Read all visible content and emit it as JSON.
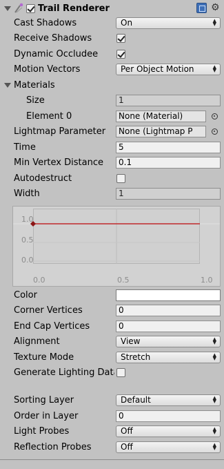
{
  "component": {
    "title": "Trail Renderer",
    "enabled": true
  },
  "colors": {
    "panel_bg": "#c2c2c2",
    "curve": "#c0282a"
  },
  "properties": {
    "cast_shadows": {
      "label": "Cast Shadows",
      "value": "On"
    },
    "receive_shadows": {
      "label": "Receive Shadows",
      "checked": true
    },
    "dynamic_occludee": {
      "label": "Dynamic Occludee",
      "checked": true
    },
    "motion_vectors": {
      "label": "Motion Vectors",
      "value": "Per Object Motion"
    },
    "materials": {
      "label": "Materials"
    },
    "size": {
      "label": "Size",
      "value": "1"
    },
    "element0": {
      "label": "Element 0",
      "value": "None (Material)"
    },
    "lightmap": {
      "label": "Lightmap Parameter",
      "value": "None (Lightmap P"
    },
    "time": {
      "label": "Time",
      "value": "5"
    },
    "min_vertex_distance": {
      "label": "Min Vertex Distance",
      "value": "0.1"
    },
    "autodestruct": {
      "label": "Autodestruct",
      "checked": false
    },
    "width": {
      "label": "Width",
      "value": "1"
    },
    "color": {
      "label": "Color",
      "value": "#ffffff"
    },
    "corner_vertices": {
      "label": "Corner Vertices",
      "value": "0"
    },
    "end_cap_vertices": {
      "label": "End Cap Vertices",
      "value": "0"
    },
    "alignment": {
      "label": "Alignment",
      "value": "View"
    },
    "texture_mode": {
      "label": "Texture Mode",
      "value": "Stretch"
    },
    "generate_lighting": {
      "label": "Generate Lighting Data",
      "checked": false
    },
    "sorting_layer": {
      "label": "Sorting Layer",
      "value": "Default"
    },
    "order_in_layer": {
      "label": "Order in Layer",
      "value": "0"
    },
    "light_probes": {
      "label": "Light Probes",
      "value": "Off"
    },
    "reflection_probes": {
      "label": "Reflection Probes",
      "value": "Off"
    }
  },
  "width_curve": {
    "y_ticks": [
      "1.0",
      "0.5",
      "0.0"
    ],
    "x_ticks": [
      "0.0",
      "0.5",
      "1.0"
    ],
    "points": [
      {
        "time": 0.0,
        "value": 1.0
      },
      {
        "time": 1.0,
        "value": 1.0
      }
    ]
  }
}
